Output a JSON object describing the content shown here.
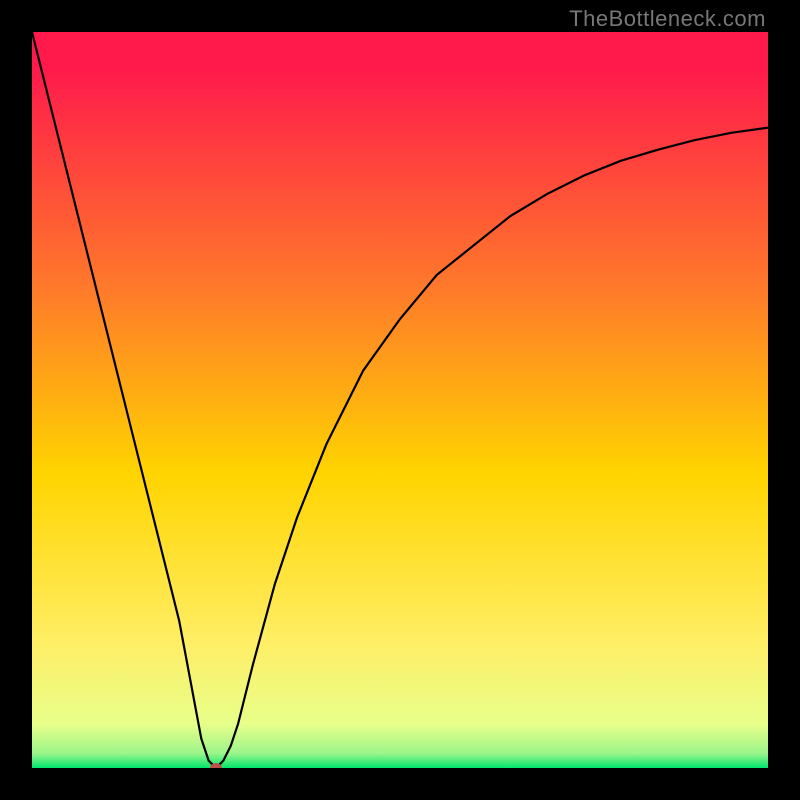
{
  "watermark": "TheBottleneck.com",
  "chart_data": {
    "type": "line",
    "title": "",
    "xlabel": "",
    "ylabel": "",
    "xlim": [
      0,
      100
    ],
    "ylim": [
      0,
      100
    ],
    "grid": false,
    "legend": false,
    "background_gradient": {
      "top_color": "#ff1a4b",
      "mid_color": "#ffd400",
      "bottom_color": "#00e66d"
    },
    "series": [
      {
        "name": "bottleneck-curve",
        "color": "#000000",
        "x": [
          0,
          5,
          10,
          15,
          20,
          23,
          24,
          25,
          26,
          27,
          28,
          30,
          33,
          36,
          40,
          45,
          50,
          55,
          60,
          65,
          70,
          75,
          80,
          85,
          90,
          95,
          100
        ],
        "y": [
          100,
          80,
          60,
          40,
          20,
          4,
          1,
          0,
          1,
          3,
          6,
          14,
          25,
          34,
          44,
          54,
          61,
          67,
          71,
          75,
          78,
          80.5,
          82.5,
          84,
          85.3,
          86.3,
          87
        ]
      }
    ],
    "markers": [
      {
        "name": "valley-marker",
        "x": 25,
        "y": 0,
        "color": "#c0504d",
        "rx": 6,
        "ry": 5
      }
    ]
  }
}
